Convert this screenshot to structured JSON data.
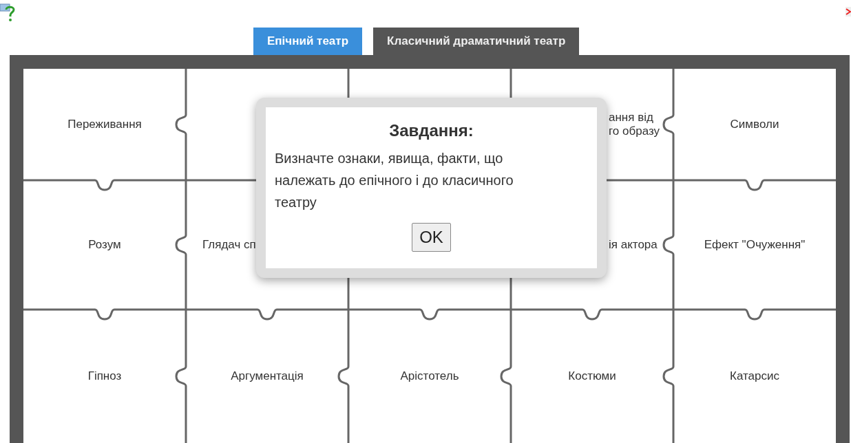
{
  "tabs": [
    {
      "label": "Епічний театр",
      "selected": true
    },
    {
      "label": "Класичний драматичний театр",
      "selected": false
    }
  ],
  "board": {
    "rows": [
      [
        {
          "label": "Переживання"
        },
        {},
        {},
        {
          "label": "ання від\nго образу"
        },
        {
          "label": "Символи"
        }
      ],
      [
        {
          "label": "Розум"
        },
        {
          "label": "Глядач сп"
        },
        {},
        {
          "label": "ія актора"
        },
        {
          "label": "Ефект \"Очуження\""
        }
      ],
      [
        {
          "label": "Гіпноз"
        },
        {
          "label": "Аргументація"
        },
        {
          "label": "Арістотель"
        },
        {
          "label": "Костюми"
        },
        {
          "label": "Катарсис"
        }
      ]
    ]
  },
  "dialog": {
    "title": "Завдання:",
    "message": "Визначте ознаки, явища, факти, що належать до епічного і до класичного театру",
    "button": "OK"
  }
}
